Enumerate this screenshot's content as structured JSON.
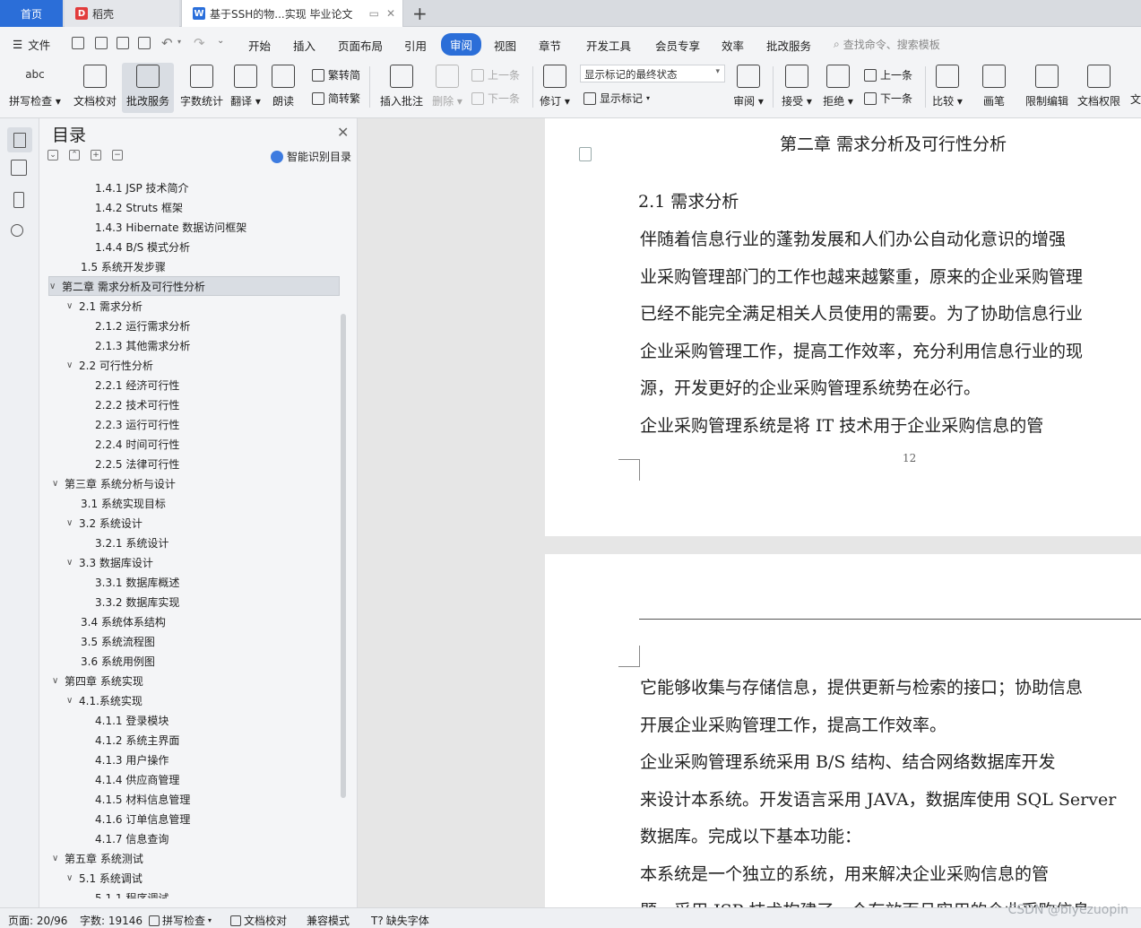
{
  "tabs": {
    "home": "首页",
    "daoke": "稻壳",
    "doc": "基于SSH的物...实现 毕业论文",
    "add": "+"
  },
  "menu": {
    "file": "文件",
    "items": [
      "开始",
      "插入",
      "页面布局",
      "引用",
      "审阅",
      "视图",
      "章节",
      "开发工具",
      "会员专享",
      "效率",
      "批改服务"
    ],
    "search": "查找命令、搜索模板"
  },
  "ribbon": {
    "spellcheck": "拼写检查",
    "doc_proof": "文档校对",
    "correction_service": "批改服务",
    "word_count": "字数统计",
    "translate": "翻译",
    "read_aloud": "朗读",
    "to_traditional": "繁转简",
    "to_simplified": "简转繁",
    "insert_comment": "插入批注",
    "delete": "删除",
    "prev": "上一条",
    "next": "下一条",
    "revise": "修订",
    "markup_state": "显示标记的最终状态",
    "show_markup": "显示标记",
    "review": "审阅",
    "accept": "接受",
    "reject": "拒绝",
    "prev2": "上一条",
    "next2": "下一条",
    "compare": "比较",
    "pen": "画笔",
    "restrict_edit": "限制编辑",
    "doc_permission": "文档权限",
    "more": "文"
  },
  "toc": {
    "title": "目录",
    "smart": "智能识别目录",
    "items": [
      {
        "text": "1.4.1 JSP 技术简介",
        "level": 3,
        "arrow": ""
      },
      {
        "text": "1.4.2 Struts  框架",
        "level": 3,
        "arrow": ""
      },
      {
        "text": "1.4.3 Hibernate 数据访问框架",
        "level": 3,
        "arrow": ""
      },
      {
        "text": "1.4.4    B/S 模式分析",
        "level": 3,
        "arrow": ""
      },
      {
        "text": "1.5  系统开发步骤",
        "level": 2,
        "arrow": ""
      },
      {
        "text": "第二章  需求分析及可行性分析",
        "level": 1,
        "arrow": "∨",
        "selected": true
      },
      {
        "text": "2.1 需求分析",
        "level": 2,
        "arrow": "∨"
      },
      {
        "text": "2.1.2 运行需求分析",
        "level": 3,
        "arrow": ""
      },
      {
        "text": "2.1.3 其他需求分析",
        "level": 3,
        "arrow": ""
      },
      {
        "text": "2.2  可行性分析",
        "level": 2,
        "arrow": "∨"
      },
      {
        "text": "2.2.1 经济可行性",
        "level": 3,
        "arrow": ""
      },
      {
        "text": "2.2.2 技术可行性",
        "level": 3,
        "arrow": ""
      },
      {
        "text": "2.2.3  运行可行性",
        "level": 3,
        "arrow": ""
      },
      {
        "text": "2.2.4 时间可行性",
        "level": 3,
        "arrow": ""
      },
      {
        "text": "2.2.5  法律可行性",
        "level": 3,
        "arrow": ""
      },
      {
        "text": "第三章  系统分析与设计",
        "level": 1,
        "arrow": "∨"
      },
      {
        "text": "3.1 系统实现目标",
        "level": 2,
        "arrow": ""
      },
      {
        "text": "3.2  系统设计",
        "level": 2,
        "arrow": "∨"
      },
      {
        "text": "3.2.1 系统设计",
        "level": 3,
        "arrow": ""
      },
      {
        "text": "3.3 数据库设计",
        "level": 2,
        "arrow": "∨"
      },
      {
        "text": "3.3.1 数据库概述",
        "level": 3,
        "arrow": ""
      },
      {
        "text": "3.3.2 数据库实现",
        "level": 3,
        "arrow": ""
      },
      {
        "text": "3.4 系统体系结构",
        "level": 2,
        "arrow": ""
      },
      {
        "text": "3.5 系统流程图",
        "level": 2,
        "arrow": ""
      },
      {
        "text": "3.6 系统用例图",
        "level": 2,
        "arrow": ""
      },
      {
        "text": "第四章  系统实现",
        "level": 1,
        "arrow": "∨"
      },
      {
        "text": "4.1.系统实现",
        "level": 2,
        "arrow": "∨"
      },
      {
        "text": "4.1.1  登录模块",
        "level": 3,
        "arrow": ""
      },
      {
        "text": "4.1.2 系统主界面",
        "level": 3,
        "arrow": ""
      },
      {
        "text": "4.1.3 用户操作",
        "level": 3,
        "arrow": ""
      },
      {
        "text": "4.1.4 供应商管理",
        "level": 3,
        "arrow": ""
      },
      {
        "text": "4.1.5 材料信息管理",
        "level": 3,
        "arrow": ""
      },
      {
        "text": "4.1.6 订单信息管理",
        "level": 3,
        "arrow": ""
      },
      {
        "text": "4.1.7 信息查询",
        "level": 3,
        "arrow": ""
      },
      {
        "text": "第五章    系统测试",
        "level": 1,
        "arrow": "∨"
      },
      {
        "text": "5.1 系统调试",
        "level": 2,
        "arrow": "∨"
      },
      {
        "text": "5.1.1  程序调试",
        "level": 3,
        "arrow": ""
      }
    ]
  },
  "document": {
    "chapter_title": "第二章  需求分析及可行性分析",
    "section_title": "2.1 需求分析",
    "page1_lines": [
      "    伴随着信息行业的蓬勃发展和人们办公自动化意识的增强",
      "业采购管理部门的工作也越来越繁重，原来的企业采购管理",
      "已经不能完全满足相关人员使用的需要。为了协助信息行业",
      "企业采购管理工作，提高工作效率，充分利用信息行业的现",
      "源，开发更好的企业采购管理系统势在必行。",
      "     企业采购管理系统是将 IT 技术用于企业采购信息的管"
    ],
    "page_number": "12",
    "page2_lines": [
      "它能够收集与存储信息，提供更新与检索的接口；协助信息",
      "开展企业采购管理工作，提高工作效率。",
      "     企业采购管理系统采用 B/S 结构、结合网络数据库开发",
      "来设计本系统。开发语言采用 JAVA，数据库使用 SQL Server",
      "数据库。完成以下基本功能：",
      "     本系统是一个独立的系统，用来解决企业采购信息的管",
      "题，采用 JSP 技术构建了一个有效而且实用的企业采购信息"
    ]
  },
  "status": {
    "page": "页面: 20/96",
    "words": "字数: 19146",
    "spellcheck": "拼写检查",
    "proof": "文档校对",
    "compat": "兼容模式",
    "missing_font": "缺失字体"
  },
  "watermark": "CSDN @biyezuopin"
}
